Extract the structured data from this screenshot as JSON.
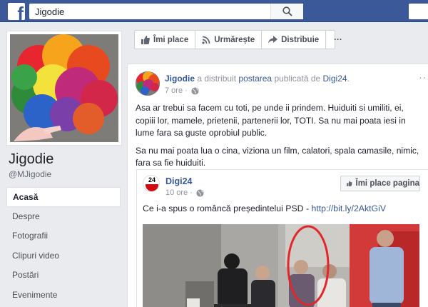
{
  "search": {
    "value": "Jigodie"
  },
  "page": {
    "name": "Jigodie",
    "handle": "@MJigodie"
  },
  "nav": [
    {
      "label": "Acasă",
      "active": true
    },
    {
      "label": "Despre"
    },
    {
      "label": "Fotografii"
    },
    {
      "label": "Clipuri video"
    },
    {
      "label": "Postări"
    },
    {
      "label": "Evenimente"
    }
  ],
  "actions": {
    "like": "Îmi place",
    "follow": "Urmărește",
    "share": "Distribuie",
    "more": "···"
  },
  "post": {
    "author": "Jigodie",
    "shared_text": "a distribuit",
    "shared_link": "postarea",
    "published_by": "publicată de",
    "source": "Digi24",
    "time": "7 ore ·",
    "paragraphs": [
      "Asa ar trebui sa facem cu toti, pe unde ii prindem. Huiduiti si umiliti, ei, copiii lor, mamele, prietenii, partenerii lor, TOTI. Sa nu mai poata iesi in lume fara sa guste oprobiul public.",
      "Sa nu mai poata lua o cina, viziona un film, calatori, spala camasile, nimic, fara sa fie huiduiti."
    ]
  },
  "shared_post": {
    "avatar_text": "24",
    "name": "Digi24",
    "time": "10 ore ·",
    "like_page": "Îmi place pagina",
    "text": "Ce i-a spus o româncă președintelui PSD - ",
    "url": "http://bit.ly/2AktGiV"
  },
  "colors": {
    "brand": "#3b5998",
    "link": "#365899",
    "background": "#e9ebee"
  },
  "icons": [
    "facebook-logo-icon",
    "search-icon",
    "thumbs-up-icon",
    "rss-icon",
    "share-arrow-icon",
    "globe-icon"
  ]
}
